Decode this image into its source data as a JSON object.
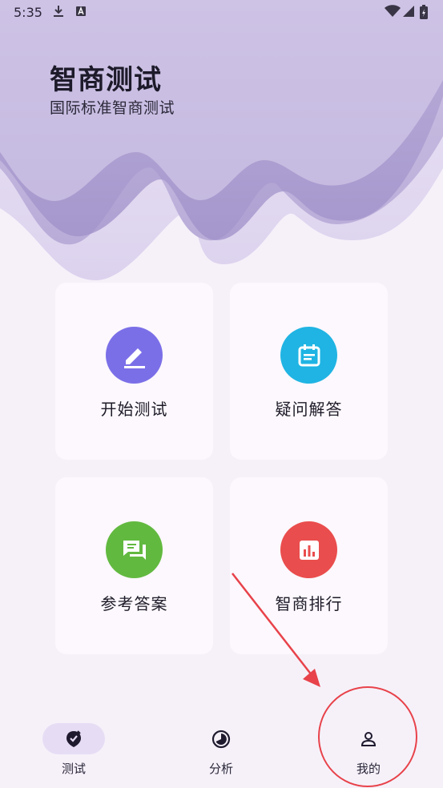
{
  "status_bar": {
    "time": "5:35"
  },
  "header": {
    "title": "智商测试",
    "subtitle": "国际标准智商测试"
  },
  "cards": [
    {
      "label": "开始测试",
      "icon": "pencil-icon",
      "color": "#7b6fe8"
    },
    {
      "label": "疑问解答",
      "icon": "calendar-icon",
      "color": "#1fb4e3"
    },
    {
      "label": "参考答案",
      "icon": "chat-icon",
      "color": "#62b93f"
    },
    {
      "label": "智商排行",
      "icon": "bar-chart-icon",
      "color": "#ea4d4d"
    }
  ],
  "bottom_nav": {
    "items": [
      {
        "label": "测试",
        "icon": "brain-check-icon",
        "active": true
      },
      {
        "label": "分析",
        "icon": "pie-chart-icon",
        "active": false
      },
      {
        "label": "我的",
        "icon": "person-icon",
        "active": false
      }
    ]
  },
  "colors": {
    "background": "#f6f1f9",
    "card": "#fcf8fd",
    "wave_light": "#e6def2",
    "wave_mid": "#cabfe2",
    "wave_dark": "#a597cb",
    "active_pill": "#e6ddf5",
    "annotation": "#e8424a"
  }
}
